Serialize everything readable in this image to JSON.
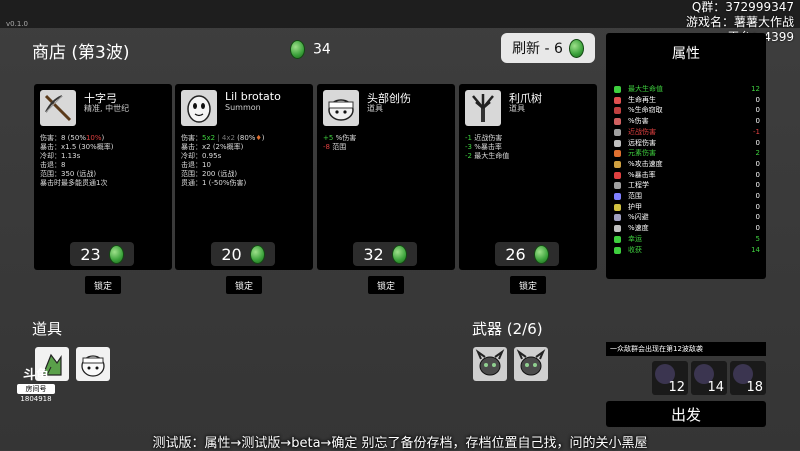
{
  "version": "v0.1.0",
  "overlay": {
    "qq": "Q群：372999347",
    "game_name": "游戏名：薯薯大作战",
    "platform": "平台：4399"
  },
  "shop": {
    "title": "商店 (第3波)",
    "coins": "34",
    "reroll_label": "刷新 - 6"
  },
  "items": [
    {
      "name": "十字弓",
      "sub": "精准, 中世纪",
      "icon": "crossbow-icon",
      "price": "23",
      "lock": "锁定",
      "stats": [
        "伤害：8 (50%",
        "暴击：x1.5 (30%概率)",
        "冷却：1.13s",
        "击退：8",
        "范围：350 (远战)",
        "暴击时最多能贯通1次"
      ],
      "stat1_tail": "10%",
      "stat1_tail2": ")"
    },
    {
      "name": "Lil brotato",
      "sub": "Summon",
      "icon": "potato-icon",
      "price": "20",
      "lock": "锁定",
      "stats": [
        "伤害：",
        "暴击：x2 (2%概率)",
        "冷却：0.95s",
        "击退：10",
        "范围：200 (远战)",
        "贯通：1 (-50%伤害)"
      ],
      "stat1_a": "5x2",
      "stat1_b": "| 4x2",
      "stat1_c": "(80%",
      "stat1_d": ")"
    },
    {
      "name": "头部创伤",
      "sub": "道具",
      "icon": "bandage-head-icon",
      "price": "32",
      "lock": "锁定",
      "lines": [
        {
          "v": "+5",
          "t": "%伤害",
          "c": "g"
        },
        {
          "v": "-8",
          "t": "范围",
          "c": "r"
        }
      ]
    },
    {
      "name": "利爪树",
      "sub": "道具",
      "icon": "claw-tree-icon",
      "price": "26",
      "lock": "锁定",
      "lines": [
        {
          "v": "-1",
          "t": "近战伤害",
          "c": "g"
        },
        {
          "v": "-3",
          "t": "%暴击率",
          "c": "g"
        },
        {
          "v": "-2",
          "t": "最大生命值",
          "c": "g"
        }
      ]
    }
  ],
  "props": {
    "label": "道具"
  },
  "weapons": {
    "label": "武器 (2/6)"
  },
  "attributes": {
    "title": "属性",
    "rows": [
      {
        "label": "最大生命值",
        "value": "12",
        "color": "#3ecf3e",
        "icon_color": "#3ecf3e"
      },
      {
        "label": "生命再生",
        "value": "0",
        "color": "#ffffff",
        "icon_color": "#e05050"
      },
      {
        "label": "%生命窃取",
        "value": "0",
        "color": "#ffffff",
        "icon_color": "#c04040"
      },
      {
        "label": "%伤害",
        "value": "0",
        "color": "#ffffff",
        "icon_color": "#d06060"
      },
      {
        "label": "近战伤害",
        "value": "-1",
        "color": "#e04040",
        "icon_color": "#a0a0a0"
      },
      {
        "label": "远程伤害",
        "value": "0",
        "color": "#ffffff",
        "icon_color": "#c0c0c0"
      },
      {
        "label": "元素伤害",
        "value": "2",
        "color": "#3ecf3e",
        "icon_color": "#e07030"
      },
      {
        "label": "%攻击速度",
        "value": "0",
        "color": "#ffffff",
        "icon_color": "#d0a040"
      },
      {
        "label": "%暴击率",
        "value": "0",
        "color": "#ffffff",
        "icon_color": "#e04040"
      },
      {
        "label": "工程学",
        "value": "0",
        "color": "#ffffff",
        "icon_color": "#a0a0a0"
      },
      {
        "label": "范围",
        "value": "0",
        "color": "#ffffff",
        "icon_color": "#8080ff"
      },
      {
        "label": "护甲",
        "value": "0",
        "color": "#ffffff",
        "icon_color": "#d0c040"
      },
      {
        "label": "%闪避",
        "value": "0",
        "color": "#ffffff",
        "icon_color": "#a0a0c0"
      },
      {
        "label": "%速度",
        "value": "0",
        "color": "#ffffff",
        "icon_color": "#c0c0c0"
      },
      {
        "label": "幸运",
        "value": "5",
        "color": "#3ecf3e",
        "icon_color": "#3ecf3e"
      },
      {
        "label": "收获",
        "value": "14",
        "color": "#3ecf3e",
        "icon_color": "#3ecf3e"
      }
    ]
  },
  "notice": "一众敌群会出现在第12波敌袭",
  "enemies": [
    {
      "icon": "horned-enemy-icon",
      "count": "12"
    },
    {
      "icon": "horned-enemy-icon",
      "count": "14"
    },
    {
      "icon": "horned-enemy-icon",
      "count": "18"
    }
  ],
  "go_label": "出发",
  "subtitle": "测试版：属性→测试版→beta→确定 别忘了备份存档，存档位置自己找，问的关小黑屋",
  "logo": {
    "line1": "斗鱼",
    "line2": "房间号",
    "line3": "1804918"
  }
}
